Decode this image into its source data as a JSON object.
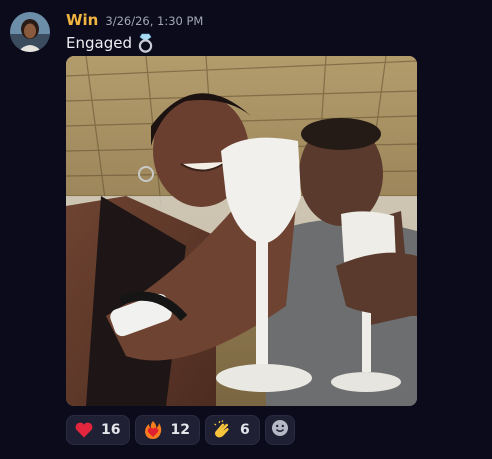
{
  "message": {
    "username": "Win",
    "timestamp": "3/26/26, 1:30 PM",
    "text": "Engaged",
    "text_emoji": "ring-icon",
    "username_color": "#f2b540"
  },
  "reactions": [
    {
      "emoji": "heart-icon",
      "count": "16"
    },
    {
      "emoji": "fire-heart-icon",
      "count": "12"
    },
    {
      "emoji": "clapping-hands-icon",
      "count": "6"
    }
  ],
  "add_reaction": {
    "icon": "add-reaction-icon"
  }
}
